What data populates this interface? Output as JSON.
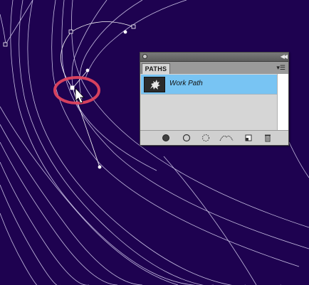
{
  "paths_panel": {
    "tab_label": "PATHS",
    "collapse_glyph": "◀◀",
    "menu_glyph": "▾☰",
    "items": [
      {
        "name": "Work Path",
        "selected": true,
        "thumbnail_icon": "path-thumbnail-icon"
      }
    ],
    "footer_buttons": [
      "fill-path-icon",
      "stroke-path-icon",
      "load-path-as-selection-icon",
      "make-work-path-icon",
      "create-new-path-icon",
      "delete-path-icon"
    ]
  },
  "colors": {
    "canvas_background": "#1e0250",
    "path_stroke": "#d9d2f2",
    "selection_row": "#78c4f3",
    "highlight_ellipse": "#e0445f"
  }
}
